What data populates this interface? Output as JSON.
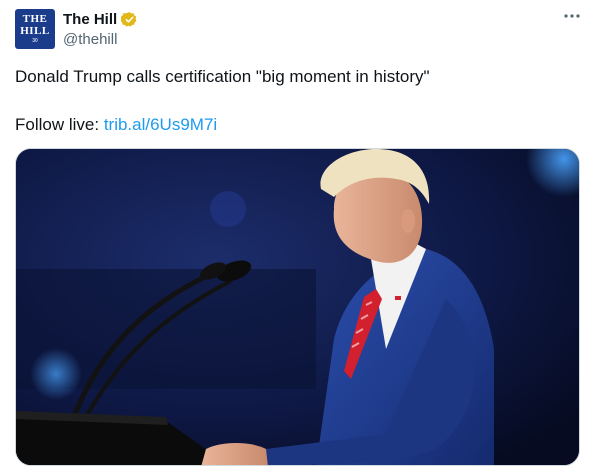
{
  "account": {
    "avatar_line1": "THE",
    "avatar_line2": "HILL",
    "avatar_line3": "30",
    "display_name": "The Hill",
    "handle": "@thehill",
    "verified_icon": "gold-verified-badge-icon"
  },
  "menu": {
    "more_glyph": "···"
  },
  "tweet": {
    "text": "Donald Trump calls certification \"big moment in history\"",
    "follow_prefix": "Follow live: ",
    "link_text": "trib.al/6Us9M7i"
  },
  "media": {
    "subject": "photo-speaker-at-podium-icon"
  },
  "colors": {
    "link": "#1d9bf0",
    "avatar_bg": "#1a3c8a",
    "verified_badge": "#e2b719",
    "secondary_text": "#536471"
  }
}
